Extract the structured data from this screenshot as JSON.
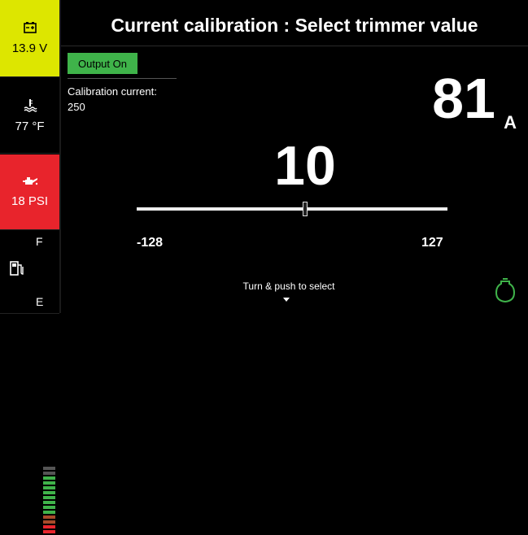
{
  "header": {
    "title": "Current calibration : Select trimmer value"
  },
  "sidebar": {
    "battery": {
      "icon": "battery-icon",
      "value": "13.9 V",
      "bg": "#dde600"
    },
    "temperature": {
      "icon": "thermometer-icon",
      "value": "77 °F"
    },
    "oil": {
      "icon": "oil-can-icon",
      "value": "18 PSI",
      "bg": "#e8242c"
    },
    "fuel": {
      "icon": "fuel-pump-icon",
      "full_label": "F",
      "empty_label": "E",
      "level": 0.85
    }
  },
  "output_badge": {
    "label": "Output On",
    "color": "#3fb34a"
  },
  "calibration": {
    "label": "Calibration current:",
    "value": "250"
  },
  "current": {
    "value": "81",
    "unit": "A"
  },
  "trimmer": {
    "value": "10",
    "min": "-128",
    "max": "127",
    "current": 10,
    "min_num": -128,
    "max_num": 127
  },
  "hint": {
    "text": "Turn & push to select"
  },
  "engine_indicator": {
    "icon": "engine-icon",
    "color": "#3fb34a"
  }
}
